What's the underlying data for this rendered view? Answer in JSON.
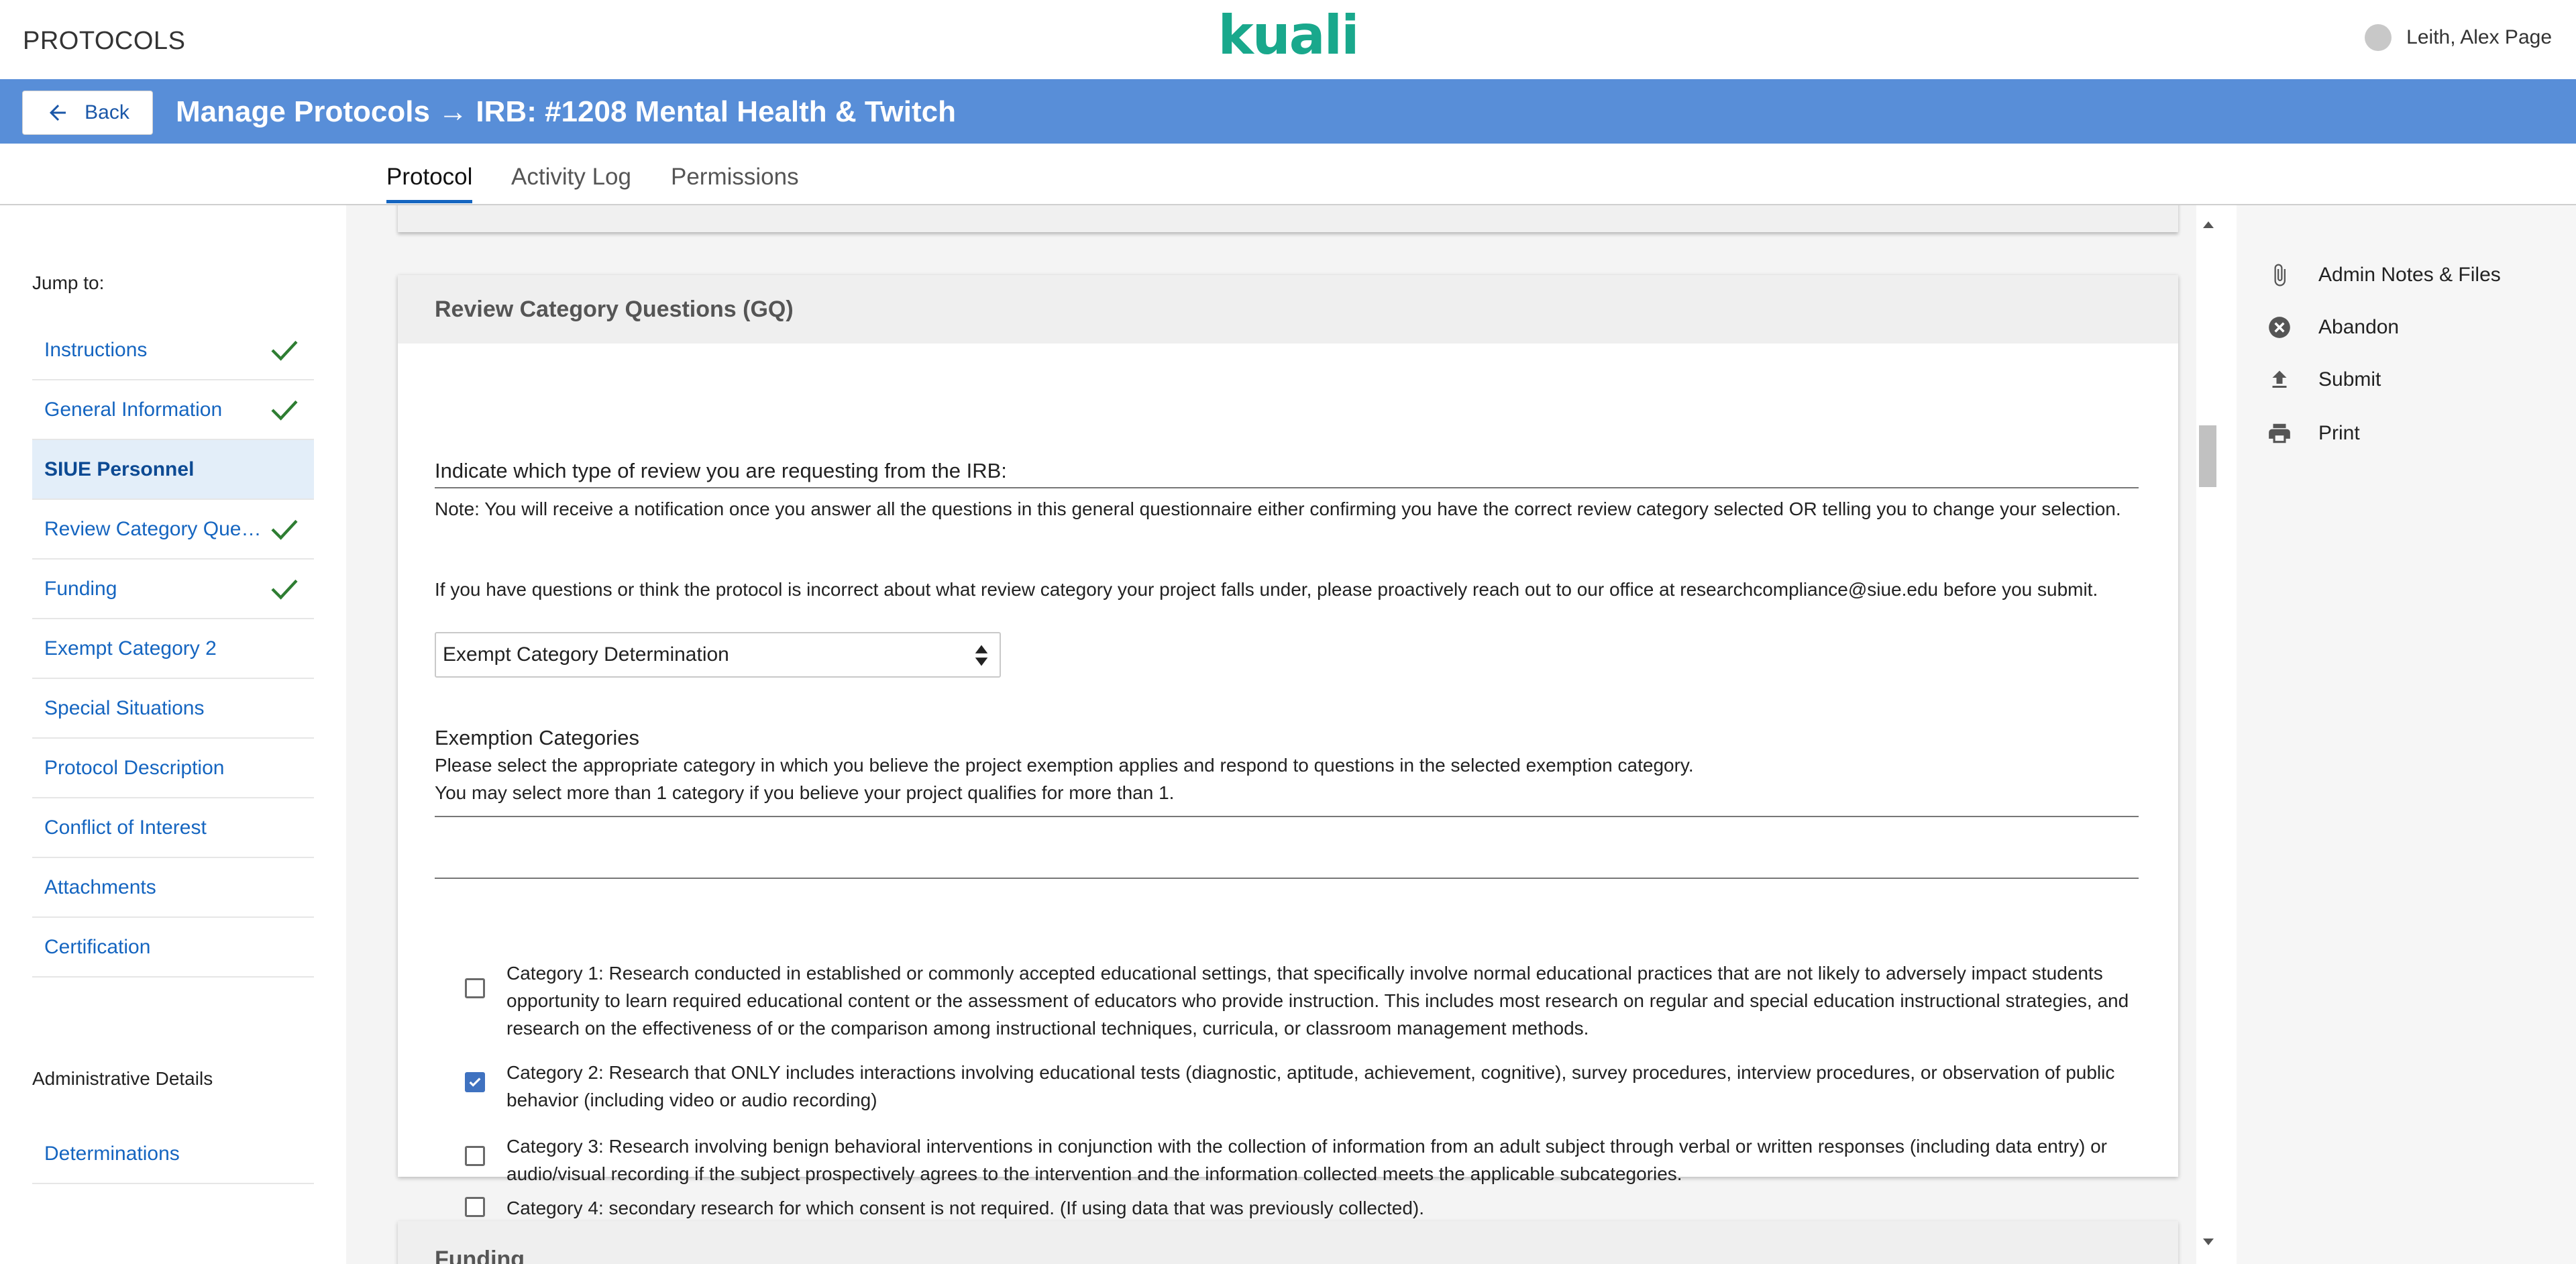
{
  "app": {
    "name": "PROTOCOLS",
    "logo": "kuali"
  },
  "user": {
    "name": "Leith, Alex Page"
  },
  "header": {
    "back_label": "Back",
    "title": "Manage Protocols → IRB: #1208 Mental Health & Twitch"
  },
  "tabs": [
    {
      "label": "Protocol",
      "active": true
    },
    {
      "label": "Activity Log",
      "active": false
    },
    {
      "label": "Permissions",
      "active": false
    }
  ],
  "sidebar": {
    "jump_label": "Jump to:",
    "items": [
      {
        "label": "Instructions",
        "complete": true
      },
      {
        "label": "General Information",
        "complete": true
      },
      {
        "label": "SIUE Personnel",
        "active": true
      },
      {
        "label": "Review Category Questions (GQ)",
        "complete": true
      },
      {
        "label": "Funding",
        "complete": true
      },
      {
        "label": "Exempt Category 2"
      },
      {
        "label": "Special Situations"
      },
      {
        "label": "Protocol Description"
      },
      {
        "label": "Conflict of Interest"
      },
      {
        "label": "Attachments"
      },
      {
        "label": "Certification"
      }
    ],
    "admin_title": "Administrative Details",
    "admin_items": [
      {
        "label": "Determinations"
      }
    ]
  },
  "section": {
    "title": "Review Category Questions (GQ)",
    "question": "Indicate which type of review you are requesting from the IRB:",
    "note": "Note: You will receive a notification once you answer all the questions in this general questionnaire either confirming you have the correct review category selected OR telling you to change your selection.",
    "note2": "If you have questions or think the protocol is incorrect about what review category your project falls under, please proactively reach out to our office at researchcompliance@siue.edu before you submit.",
    "select_value": "Exempt Category Determination",
    "exemption_title": "Exemption Categories",
    "exemption_desc_1": "Please select the appropriate category in which you believe the project exemption applies and respond to questions in the selected exemption category.",
    "exemption_desc_2": "You may select more than 1 category if you believe your project qualifies for more than 1.",
    "categories": [
      {
        "text": "Category 1: Research conducted in established or commonly accepted educational settings, that specifically involve normal educational practices that are not likely to adversely impact students opportunity to learn required educational content or the assessment of educators who provide instruction. This includes most research on regular and special education instructional strategies, and research on the effectiveness of or the comparison among instructional techniques, curricula, or classroom management methods.",
        "checked": false
      },
      {
        "text": "Category 2: Research that ONLY includes interactions involving educational tests (diagnostic, aptitude, achievement, cognitive), survey procedures, interview procedures, or observation of public behavior (including video or audio recording)",
        "checked": true
      },
      {
        "text": "Category 3: Research involving benign behavioral interventions in conjunction with the collection of information from an adult subject through verbal or written responses (including data entry) or audio/visual recording if the subject prospectively agrees to the intervention and the information collected meets the applicable subcategories.",
        "checked": false
      },
      {
        "text": "Category 4: secondary research for which consent is not required. (If using data that was previously collected).",
        "checked": false
      }
    ],
    "next_section_title": "Funding"
  },
  "actions": [
    {
      "label": "Admin Notes & Files",
      "icon": "paperclip-icon"
    },
    {
      "label": "Abandon",
      "icon": "cancel-circle-icon"
    },
    {
      "label": "Submit",
      "icon": "upload-icon"
    },
    {
      "label": "Print",
      "icon": "printer-icon"
    }
  ],
  "colors": {
    "header_blue": "#588ed8",
    "link_blue": "#1565c0",
    "check_green": "#2e7d32",
    "brand_green": "#19a88c"
  }
}
